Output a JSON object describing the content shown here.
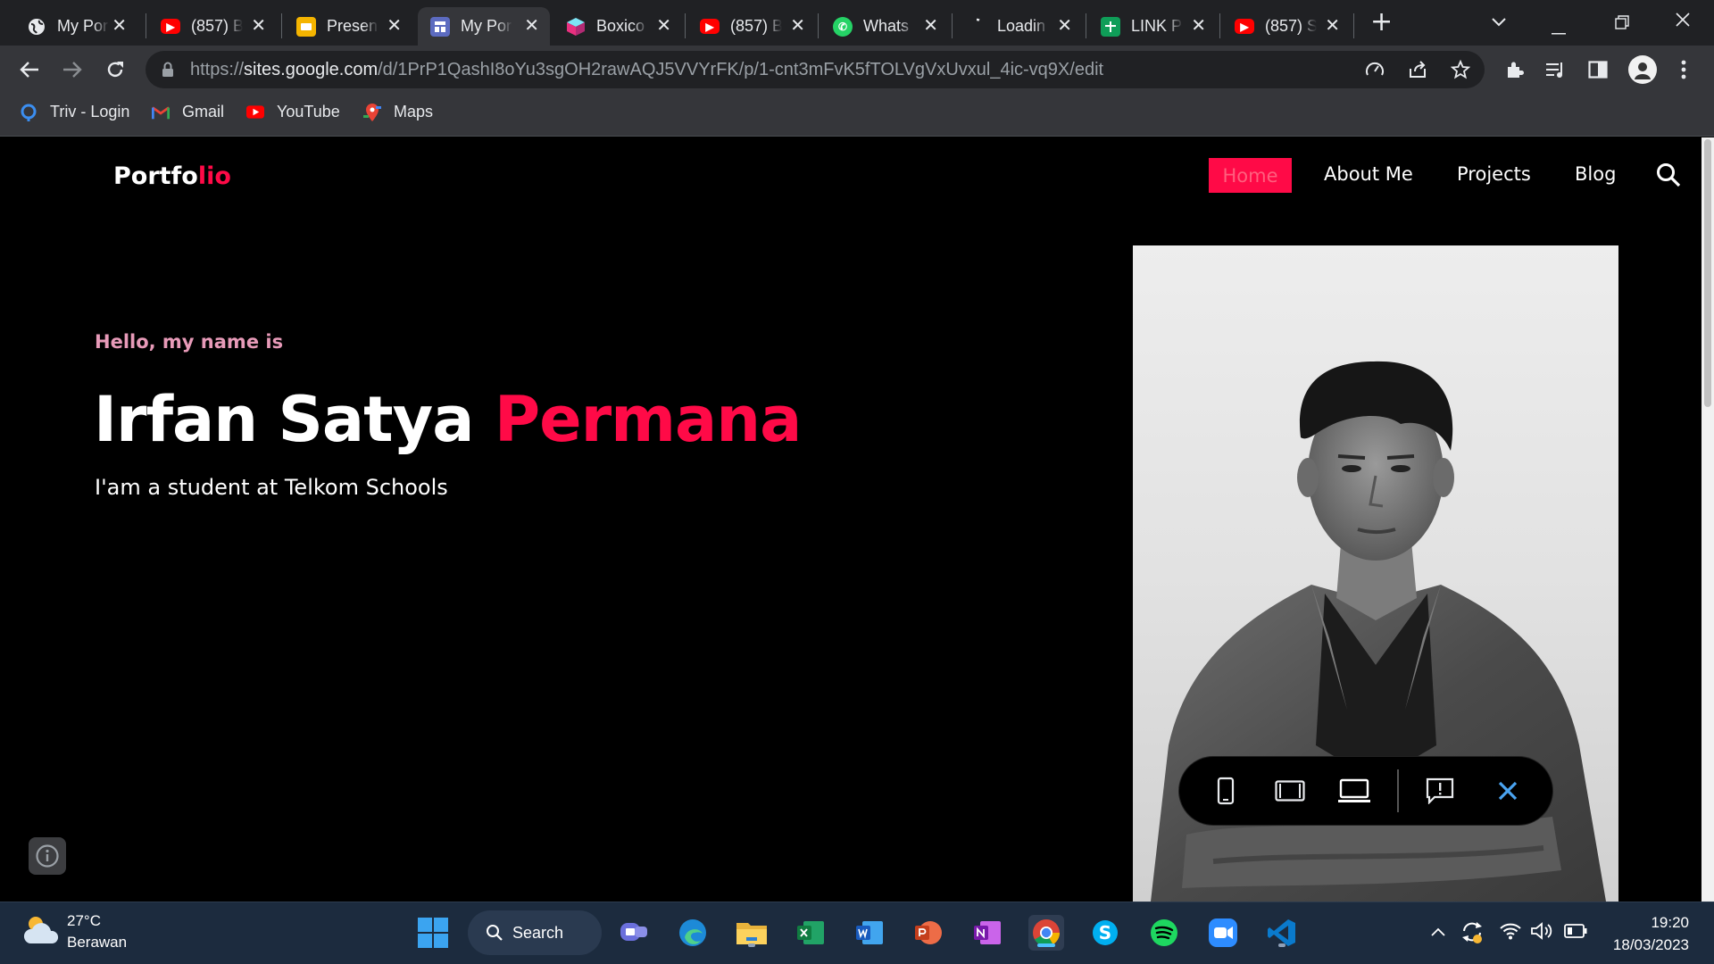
{
  "browser": {
    "tabs": [
      {
        "title": "My Por",
        "icon": "globe-icon",
        "active": false
      },
      {
        "title": "(857) B",
        "icon": "youtube-icon",
        "active": false
      },
      {
        "title": "Presen",
        "icon": "slides-icon",
        "active": false
      },
      {
        "title": "My Por",
        "icon": "sites-icon",
        "active": true
      },
      {
        "title": "Boxico",
        "icon": "boxicons-icon",
        "active": false
      },
      {
        "title": "(857) B",
        "icon": "youtube-icon",
        "active": false
      },
      {
        "title": "Whats",
        "icon": "whatsapp-icon",
        "active": false
      },
      {
        "title": "Loadin",
        "icon": "loading-icon",
        "active": false
      },
      {
        "title": "LINK P",
        "icon": "sheets-icon",
        "active": false
      },
      {
        "title": "(857) S",
        "icon": "youtube-icon",
        "active": false
      }
    ],
    "url_prefix": "https://",
    "url_domain": "sites.google.com",
    "url_path": "/d/1PrP1QashI8oYu3sgOH2rawAQJ5VVYrFK/p/1-cnt3mFvK5fTOLVgVxUvxul_4ic-vq9X/edit",
    "bookmarks": [
      {
        "label": "Triv - Login",
        "icon": "triv-icon"
      },
      {
        "label": "Gmail",
        "icon": "gmail-icon"
      },
      {
        "label": "YouTube",
        "icon": "youtube-icon"
      },
      {
        "label": "Maps",
        "icon": "maps-icon"
      }
    ]
  },
  "site": {
    "logo_part1": "Portfo",
    "logo_part2": "lio",
    "nav": {
      "home": "Home",
      "about": "About Me",
      "projects": "Projects",
      "blog": "Blog"
    },
    "hero": {
      "greeting": "Hello, my name is",
      "first_name": "Irfan Satya ",
      "last_name": "Permana",
      "tagline": "I'am a student at Telkom Schools"
    }
  },
  "taskbar": {
    "weather_temp": "27°C",
    "weather_desc": "Berawan",
    "search_label": "Search",
    "time": "19:20",
    "date": "18/03/2023"
  },
  "colors": {
    "accent": "#ff0a47",
    "greeting": "#e79ab8",
    "browser_bg": "#202124",
    "taskbar_bg": "#1c2b3e"
  }
}
